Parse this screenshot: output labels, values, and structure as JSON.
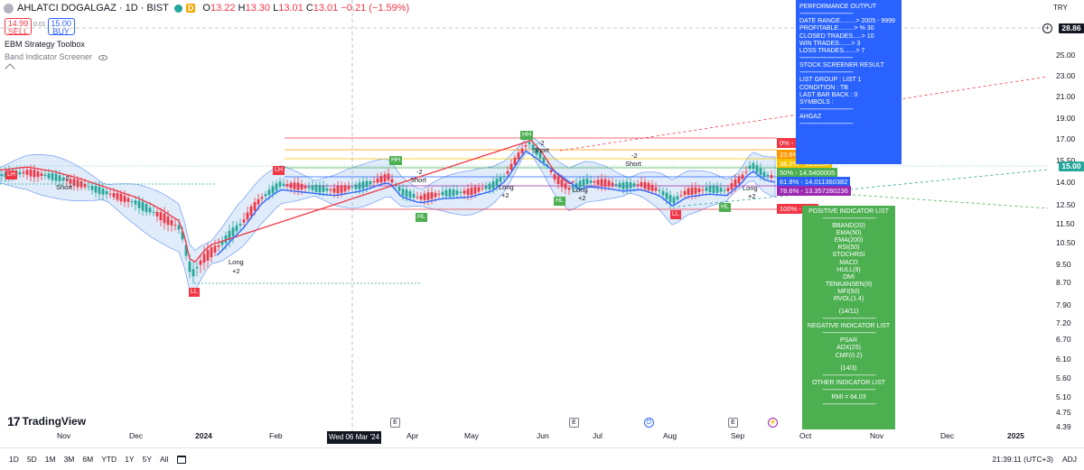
{
  "header": {
    "symbol": "AHLATCI DOGALGAZ · 1D · BIST",
    "badge": "D",
    "o_label": "O",
    "o": "13.22",
    "h_label": "H",
    "h": "13.30",
    "l_label": "L",
    "l": "13.01",
    "c_label": "C",
    "c": "13.01",
    "change": "−0.21 (−1.59%)"
  },
  "trade": {
    "sell_price": "14.99",
    "sell_label": "SELL",
    "spread": "0.01",
    "buy_price": "15.00",
    "buy_label": "BUY"
  },
  "indicators": [
    "EBM Strategy Toolbox",
    "Band Indicator Screener"
  ],
  "axis": {
    "currency": "TRY",
    "price_ticks": [
      "28.86",
      "25.00",
      "23.00",
      "21.00",
      "19.00",
      "17.00",
      "15.50",
      "14.00",
      "12.50",
      "11.50",
      "10.50",
      "9.50",
      "8.70",
      "7.90",
      "7.20",
      "6.70",
      "6.10",
      "5.60",
      "5.10",
      "4.75",
      "4.39"
    ],
    "crosshair_price": "28.86",
    "last_price": "15.00",
    "time_ticks": [
      "Nov",
      "Dec",
      "2024",
      "Feb",
      "Apr",
      "May",
      "Jun",
      "Jul",
      "Aug",
      "Sep",
      "Oct",
      "Nov",
      "Dec",
      "2025"
    ],
    "crosshair_date": "Wed 06 Mar '24"
  },
  "events": [
    "E",
    "E",
    "D",
    "E",
    "⚡"
  ],
  "brand": {
    "logo": "17",
    "name": "TradingView"
  },
  "bottom": {
    "ranges": [
      "1D",
      "5D",
      "1M",
      "3M",
      "6M",
      "YTD",
      "1Y",
      "5Y",
      "All"
    ],
    "clock": "21:39:11 (UTC+3)",
    "adj": "ADJ"
  },
  "fib": [
    {
      "label": "0% - 16.780001",
      "color": "#f23645"
    },
    {
      "label": "23.6% - 15.821280786",
      "color": "#ff9800"
    },
    {
      "label": "38.2% - 15.2284",
      "color": "#f5c400"
    },
    {
      "label": "50% - 14.5400005",
      "color": "#4caf50"
    },
    {
      "label": "61.8% - 14.011360382",
      "color": "#2962ff"
    },
    {
      "label": "78.6% - 13.357280236",
      "color": "#9c27b0"
    },
    {
      "label": "100% - 12.3",
      "color": "#f23645"
    }
  ],
  "pivots": [
    {
      "label": "LH",
      "color": "#f23645"
    },
    {
      "label": "LL",
      "color": "#f23645"
    },
    {
      "label": "LH",
      "color": "#f23645"
    },
    {
      "label": "HH",
      "color": "#4caf50"
    },
    {
      "label": "HL",
      "color": "#4caf50"
    },
    {
      "label": "HH",
      "color": "#4caf50"
    },
    {
      "label": "HL",
      "color": "#4caf50"
    },
    {
      "label": "LL",
      "color": "#f23645"
    },
    {
      "label": "HL",
      "color": "#4caf50"
    }
  ],
  "signals": [
    "-2",
    "Short",
    "Long",
    "+2",
    "-2",
    "Short",
    "Long",
    "+2",
    "-2",
    "Short",
    "Long",
    "+2",
    "-2",
    "Short",
    "Long",
    "+2"
  ],
  "performance": {
    "title": "PERFORMANCE OUTPUT",
    "sep": "--------------------------------------------",
    "lines": [
      "DATE RANGE.........> 2005 - 9999",
      "PROFITABLE.........> % 30",
      "CLOSED TRADES.....> 10",
      "WIN TRADES.......> 3",
      "LOSS TRADES.......> 7"
    ],
    "screener_title": "STOCK SCREENER RESULT",
    "screener_lines": [
      "LIST GROUP : LIST 1",
      "CONDITION : TB",
      "LAST BAR BACK : 0",
      "SYMBOLS :"
    ],
    "symbol": "AHGAZ"
  },
  "indicator_list": {
    "positive_title": "POSITIVE INDICATOR LIST",
    "positive": [
      "BBAND(20)",
      "EMA(50)",
      "EMA(200)",
      "RSI(50)",
      "STOCHRSI",
      "MACD",
      "HULL(9)",
      "DMI",
      "TENKANSEN(9)",
      "MFI(50)",
      "RVOL(1.4)"
    ],
    "positive_count": "(14/11)",
    "negative_title": "NEGATIVE INDICATOR LIST",
    "negative": [
      "PSAR",
      "ADX(25)",
      "CMF(0.2)"
    ],
    "negative_count": "(14/3)",
    "other_title": "OTHER INDICATOR LIST",
    "rmi": "RMI = 64.03",
    "sep": "--------------------------------------------"
  },
  "colors": {
    "up": "#26a69a",
    "down": "#f23645",
    "band_fill": "#c7dcf5",
    "perf_bg": "#2962ff",
    "ind_bg": "#4caf50"
  }
}
